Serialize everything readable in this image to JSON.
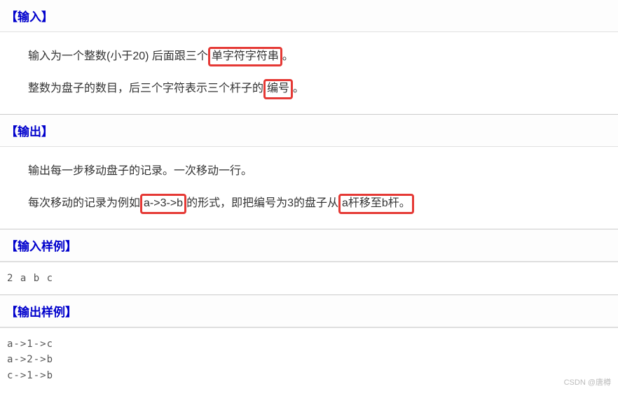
{
  "sections": {
    "input": {
      "title": "【输入】",
      "para1_a": "输入为一个整数(小于20)  后面跟三个",
      "para1_box1": "单字符字符串",
      "para1_b": "。",
      "para2_a": "整数为盘子的数目，后三个字符表示三个杆子的",
      "para2_box1": "编号",
      "para2_b": "。"
    },
    "output": {
      "title": "【输出】",
      "para1": "输出每一步移动盘子的记录。一次移动一行。",
      "para2_a": "每次移动的记录为例如",
      "para2_box1": " a->3->b ",
      "para2_b": "的形式，即把编号为3的盘子从",
      "para2_box2": "a杆移至b杆。"
    },
    "input_sample": {
      "title": "【输入样例】",
      "code": "2 a b c"
    },
    "output_sample": {
      "title": "【输出样例】",
      "code": "a->1->c\na->2->b\nc->1->b"
    }
  },
  "watermark": "CSDN @唐樽"
}
